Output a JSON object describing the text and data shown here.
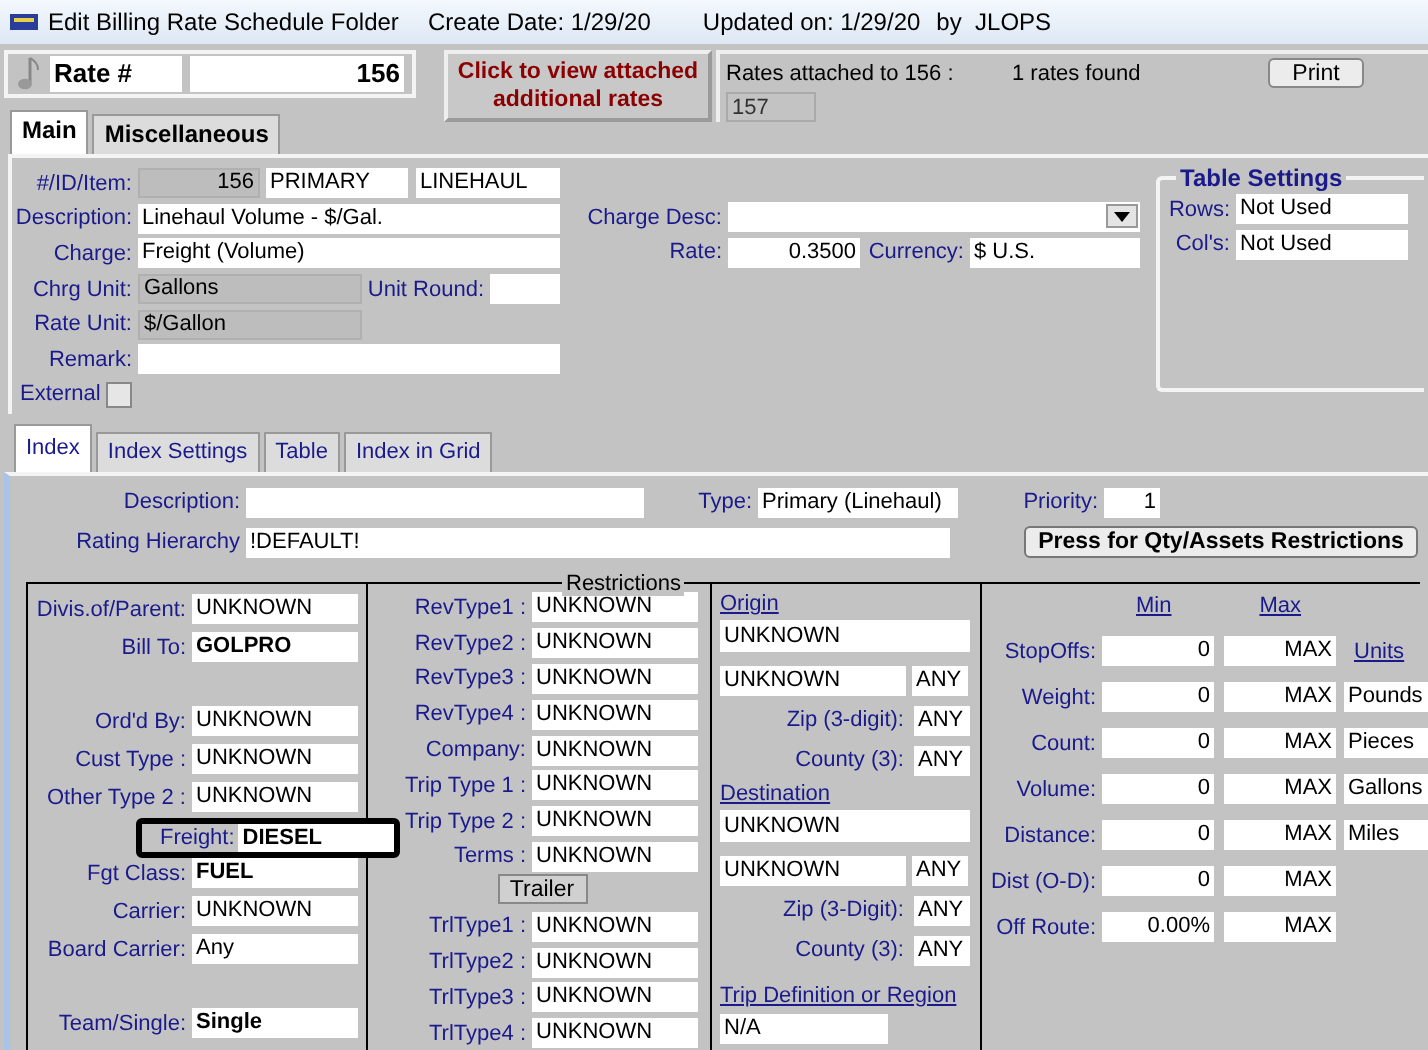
{
  "window": {
    "title": "Edit Billing Rate Schedule Folder",
    "create_label": "Create Date:",
    "create_date": "1/29/20",
    "updated_label": "Updated on:",
    "updated_date": "1/29/20",
    "by_label": "by",
    "user": "JLOPS"
  },
  "rate": {
    "label": "Rate #",
    "value": "156"
  },
  "attached_button": "Click to view attached additional rates",
  "rates_attached": {
    "label": "Rates attached to 156 :",
    "count": "1 rates found",
    "rates": [
      "157"
    ],
    "print_button": "Print"
  },
  "main_tabs": [
    {
      "label": "Main",
      "selected": true
    },
    {
      "label": "Miscellaneous",
      "selected": false
    }
  ],
  "main": {
    "id_label": "#/ID/Item:",
    "id_values": [
      {
        "value": "156",
        "readonly": true
      },
      {
        "value": "PRIMARY",
        "readonly": false
      },
      {
        "value": "LINEHAUL",
        "readonly": false
      }
    ],
    "description": {
      "label": "Description:",
      "value": "Linehaul Volume - $/Gal."
    },
    "charge": {
      "label": "Charge:",
      "value": "Freight (Volume)"
    },
    "chrg_unit": {
      "label": "Chrg Unit:",
      "value": "Gallons",
      "readonly": true
    },
    "unit_round": {
      "label": "Unit Round:"
    },
    "rate_unit": {
      "label": "Rate Unit:",
      "value": "$/Gallon",
      "readonly": true
    },
    "remark": {
      "label": "Remark:"
    },
    "external": {
      "label": "External",
      "checked": false
    },
    "charge_desc": {
      "label": "Charge Desc:"
    },
    "rate": {
      "label": "Rate:",
      "value": "0.3500"
    },
    "currency": {
      "label": "Currency:",
      "value": "$ U.S."
    },
    "table_settings": {
      "title": "Table Settings",
      "rows": {
        "label": "Rows:",
        "value": "Not Used"
      },
      "cols": {
        "label": "Col's:",
        "value": "Not Used"
      }
    }
  },
  "index_tabs": [
    {
      "label": "Index",
      "selected": true
    },
    {
      "label": "Index Settings",
      "selected": false
    },
    {
      "label": "Table",
      "selected": false
    },
    {
      "label": "Index in Grid",
      "selected": false
    }
  ],
  "index": {
    "description": {
      "label": "Description:"
    },
    "type": {
      "label": "Type:",
      "value": "Primary (Linehaul)"
    },
    "priority": {
      "label": "Priority:",
      "value": "1"
    },
    "rating_hierarchy": {
      "label": "Rating Hierarchy",
      "value": "!DEFAULT!"
    },
    "restrictions_button": "Press for Qty/Assets Restrictions"
  },
  "restrictions": {
    "title": "Restrictions",
    "column_1": [
      [
        {
          "label": "Divis.of/Parent:",
          "value": "UNKNOWN",
          "bold": false,
          "focused": false
        },
        {
          "label": "Bill To:",
          "value": "GOLPRO",
          "bold": true,
          "focused": false
        }
      ],
      [
        {
          "label": "Ord'd By:",
          "value": "UNKNOWN",
          "bold": false,
          "focused": false
        },
        {
          "label": "Cust Type :",
          "value": "UNKNOWN",
          "bold": false,
          "focused": false
        },
        {
          "label": "Other Type 2 :",
          "value": "UNKNOWN",
          "bold": false,
          "focused": false
        },
        {
          "label": "Freight:",
          "value": "DIESEL",
          "bold": true,
          "focused": true
        },
        {
          "label": "Fgt Class:",
          "value": "FUEL",
          "bold": true,
          "focused": false
        },
        {
          "label": "Carrier:",
          "value": "UNKNOWN",
          "bold": false,
          "focused": false
        },
        {
          "label": "Board Carrier:",
          "value": "Any",
          "bold": false,
          "focused": false
        }
      ],
      [
        {
          "label": "Team/Single:",
          "value": "Single",
          "bold": true,
          "focused": false
        }
      ]
    ],
    "column_2": [
      {
        "label": "RevType1 :",
        "value": "UNKNOWN"
      },
      {
        "label": "RevType2 :",
        "value": "UNKNOWN"
      },
      {
        "label": "RevType3 :",
        "value": "UNKNOWN"
      },
      {
        "label": "RevType4 :",
        "value": "UNKNOWN"
      },
      {
        "label": "Company:",
        "value": "UNKNOWN"
      },
      {
        "label": "Trip Type 1 :",
        "value": "UNKNOWN"
      },
      {
        "label": "Trip Type 2 :",
        "value": "UNKNOWN"
      },
      {
        "label": "Terms  :",
        "value": "UNKNOWN"
      }
    ],
    "trailer_button": "Trailer",
    "trailer_types": [
      {
        "label": "TrlType1 :",
        "value": "UNKNOWN"
      },
      {
        "label": "TrlType2 :",
        "value": "UNKNOWN"
      },
      {
        "label": "TrlType3 :",
        "value": "UNKNOWN"
      },
      {
        "label": "TrlType4 :",
        "value": "UNKNOWN"
      }
    ],
    "places": [
      {
        "title": "Origin",
        "name": "UNKNOWN",
        "city": "UNKNOWN",
        "state": "ANY",
        "zip": {
          "label": "Zip (3-digit):",
          "value": "ANY"
        },
        "county": {
          "label": "County (3):",
          "value": "ANY"
        }
      },
      {
        "title": "Destination",
        "name": "UNKNOWN",
        "city": "UNKNOWN",
        "state": "ANY",
        "zip": {
          "label": "Zip (3-Digit):",
          "value": "ANY"
        },
        "county": {
          "label": "County (3):",
          "value": "ANY"
        }
      }
    ],
    "trip": {
      "title": "Trip Definition or Region",
      "value": "N/A"
    },
    "min_label": "Min",
    "max_label": "Max",
    "units_label": "Units",
    "limits": [
      {
        "label": "StopOffs:",
        "min": "0",
        "max": "MAX"
      },
      {
        "label": "Weight:",
        "min": "0",
        "max": "MAX",
        "unit": "Pounds"
      },
      {
        "label": "Count:",
        "min": "0",
        "max": "MAX",
        "unit": "Pieces"
      },
      {
        "label": "Volume:",
        "min": "0",
        "max": "MAX",
        "unit": "Gallons"
      },
      {
        "label": "Distance:",
        "min": "0",
        "max": "MAX",
        "unit": "Miles"
      },
      {
        "label": "Dist (O-D):",
        "min": "0",
        "max": "MAX"
      },
      {
        "label": "Off Route:",
        "min": "0.00%",
        "max": "MAX"
      }
    ]
  }
}
